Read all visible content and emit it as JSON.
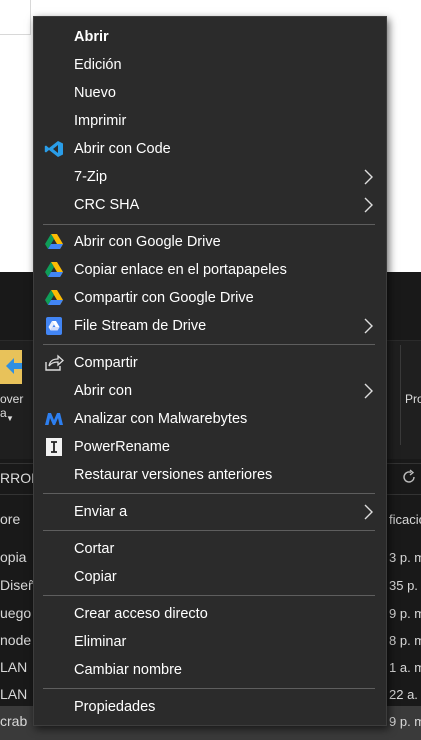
{
  "background": {
    "ribbon": {
      "move_label_line1": "over",
      "move_label_line2": "a",
      "pro_label": "Pro"
    },
    "address_fragment": "RROL",
    "left_fragments": [
      "ore",
      "opia",
      "Diseñ",
      "uego",
      "node",
      "LAN",
      "LAN",
      "crab"
    ],
    "right_fragments": [
      "ficacio",
      "3 p. m",
      "35 p.",
      "9 p. m",
      "8 p. m",
      "1 a. m",
      "22 a.",
      "9 p. m"
    ]
  },
  "menu": {
    "items": [
      {
        "label": "Abrir",
        "bold": true
      },
      {
        "label": "Edición"
      },
      {
        "label": "Nuevo"
      },
      {
        "label": "Imprimir"
      },
      {
        "label": "Abrir con Code",
        "icon": "vscode-icon"
      },
      {
        "label": "7-Zip",
        "submenu": true
      },
      {
        "label": "CRC SHA",
        "submenu": true
      },
      {
        "label": "Abrir con Google Drive",
        "icon": "google-drive-icon"
      },
      {
        "label": "Copiar enlace en el portapapeles",
        "icon": "google-drive-icon"
      },
      {
        "label": "Compartir con Google Drive",
        "icon": "google-drive-icon"
      },
      {
        "label": "File Stream de Drive",
        "icon": "drive-file-stream-icon",
        "submenu": true
      },
      {
        "label": "Compartir",
        "icon": "share-icon"
      },
      {
        "label": "Abrir con",
        "submenu": true
      },
      {
        "label": "Analizar con Malwarebytes",
        "icon": "malwarebytes-icon"
      },
      {
        "label": "PowerRename",
        "icon": "powerrename-icon"
      },
      {
        "label": "Restaurar versiones anteriores"
      },
      {
        "label": "Enviar a",
        "submenu": true
      },
      {
        "label": "Cortar"
      },
      {
        "label": "Copiar"
      },
      {
        "label": "Crear acceso directo"
      },
      {
        "label": "Eliminar"
      },
      {
        "label": "Cambiar nombre"
      },
      {
        "label": "Propiedades"
      }
    ]
  },
  "colors": {
    "menu_bg": "#2b2b2b",
    "menu_text": "#ffffff",
    "separator": "#5e5e5e"
  }
}
